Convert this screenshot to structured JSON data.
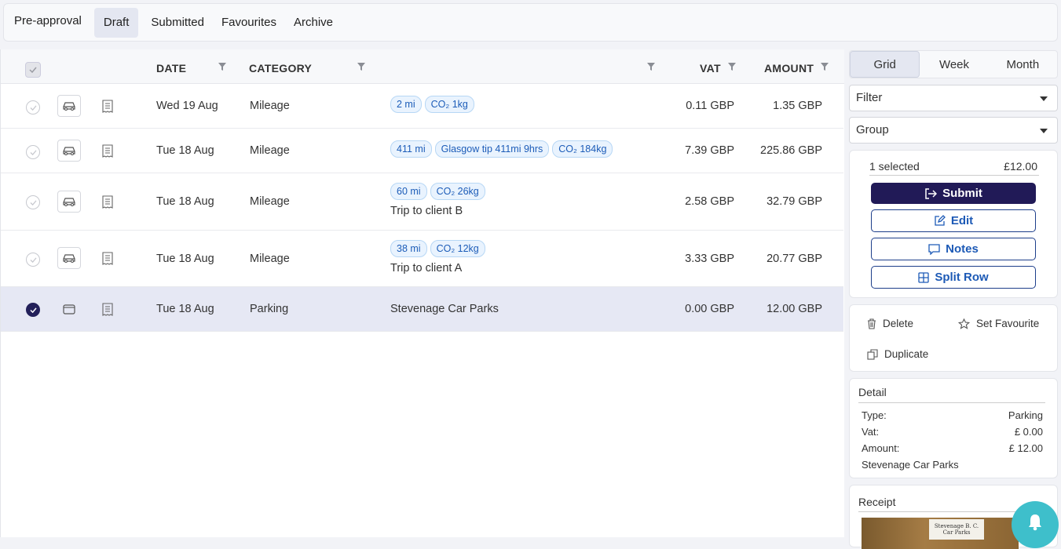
{
  "tabs": [
    {
      "label": "Pre-approval",
      "active": false
    },
    {
      "label": "Draft",
      "active": true
    },
    {
      "label": "Submitted",
      "active": false
    },
    {
      "label": "Favourites",
      "active": false
    },
    {
      "label": "Archive",
      "active": false
    }
  ],
  "grid": {
    "headers": {
      "date": "DATE",
      "category": "CATEGORY",
      "vat": "VAT",
      "amount": "AMOUNT"
    },
    "rows": [
      {
        "date": "Wed 19 Aug",
        "category": "Mileage",
        "badges": [
          "2 mi",
          "CO₂ 1kg"
        ],
        "desc": "",
        "vat": "0.11 GBP",
        "amount": "1.35 GBP",
        "type_icon": "car-icon",
        "selected": false
      },
      {
        "date": "Tue 18 Aug",
        "category": "Mileage",
        "badges": [
          "411 mi",
          "Glasgow tip 411mi 9hrs",
          "CO₂ 184kg"
        ],
        "desc": "",
        "vat": "7.39 GBP",
        "amount": "225.86 GBP",
        "type_icon": "car-icon",
        "selected": false
      },
      {
        "date": "Tue 18 Aug",
        "category": "Mileage",
        "badges": [
          "60 mi",
          "CO₂ 26kg"
        ],
        "desc": "Trip to client B",
        "vat": "2.58 GBP",
        "amount": "32.79 GBP",
        "type_icon": "car-icon",
        "selected": false
      },
      {
        "date": "Tue 18 Aug",
        "category": "Mileage",
        "badges": [
          "38 mi",
          "CO₂ 12kg"
        ],
        "desc": "Trip to client A",
        "vat": "3.33 GBP",
        "amount": "20.77 GBP",
        "type_icon": "car-icon",
        "selected": false
      },
      {
        "date": "Tue 18 Aug",
        "category": "Parking",
        "badges": [],
        "desc": "Stevenage Car Parks",
        "vat": "0.00 GBP",
        "amount": "12.00 GBP",
        "type_icon": "wallet-icon",
        "selected": true
      }
    ]
  },
  "views": [
    {
      "label": "Grid",
      "active": true
    },
    {
      "label": "Week",
      "active": false
    },
    {
      "label": "Month",
      "active": false
    }
  ],
  "filter": {
    "label": "Filter"
  },
  "group": {
    "label": "Group"
  },
  "selection": {
    "count_text": "1 selected",
    "total": "£12.00"
  },
  "actions": {
    "submit": "Submit",
    "edit": "Edit",
    "notes": "Notes",
    "split": "Split Row"
  },
  "misc": {
    "delete": "Delete",
    "favourite": "Set Favourite",
    "duplicate": "Duplicate"
  },
  "detail": {
    "title": "Detail",
    "type_label": "Type:",
    "type_value": "Parking",
    "vat_label": "Vat:",
    "vat_value": "£ 0.00",
    "amount_label": "Amount:",
    "amount_value": "£ 12.00",
    "description": "Stevenage Car Parks"
  },
  "receipt": {
    "title": "Receipt",
    "image_text_line1": "Stevenage B. C.",
    "image_text_line2": "Car Parks"
  },
  "colors": {
    "primary": "#211a57",
    "accent_blue": "#1d5ab6",
    "badge_bg": "#e9f3fe",
    "selected_row": "#e6e8f4",
    "bell": "#3ebfcb"
  }
}
